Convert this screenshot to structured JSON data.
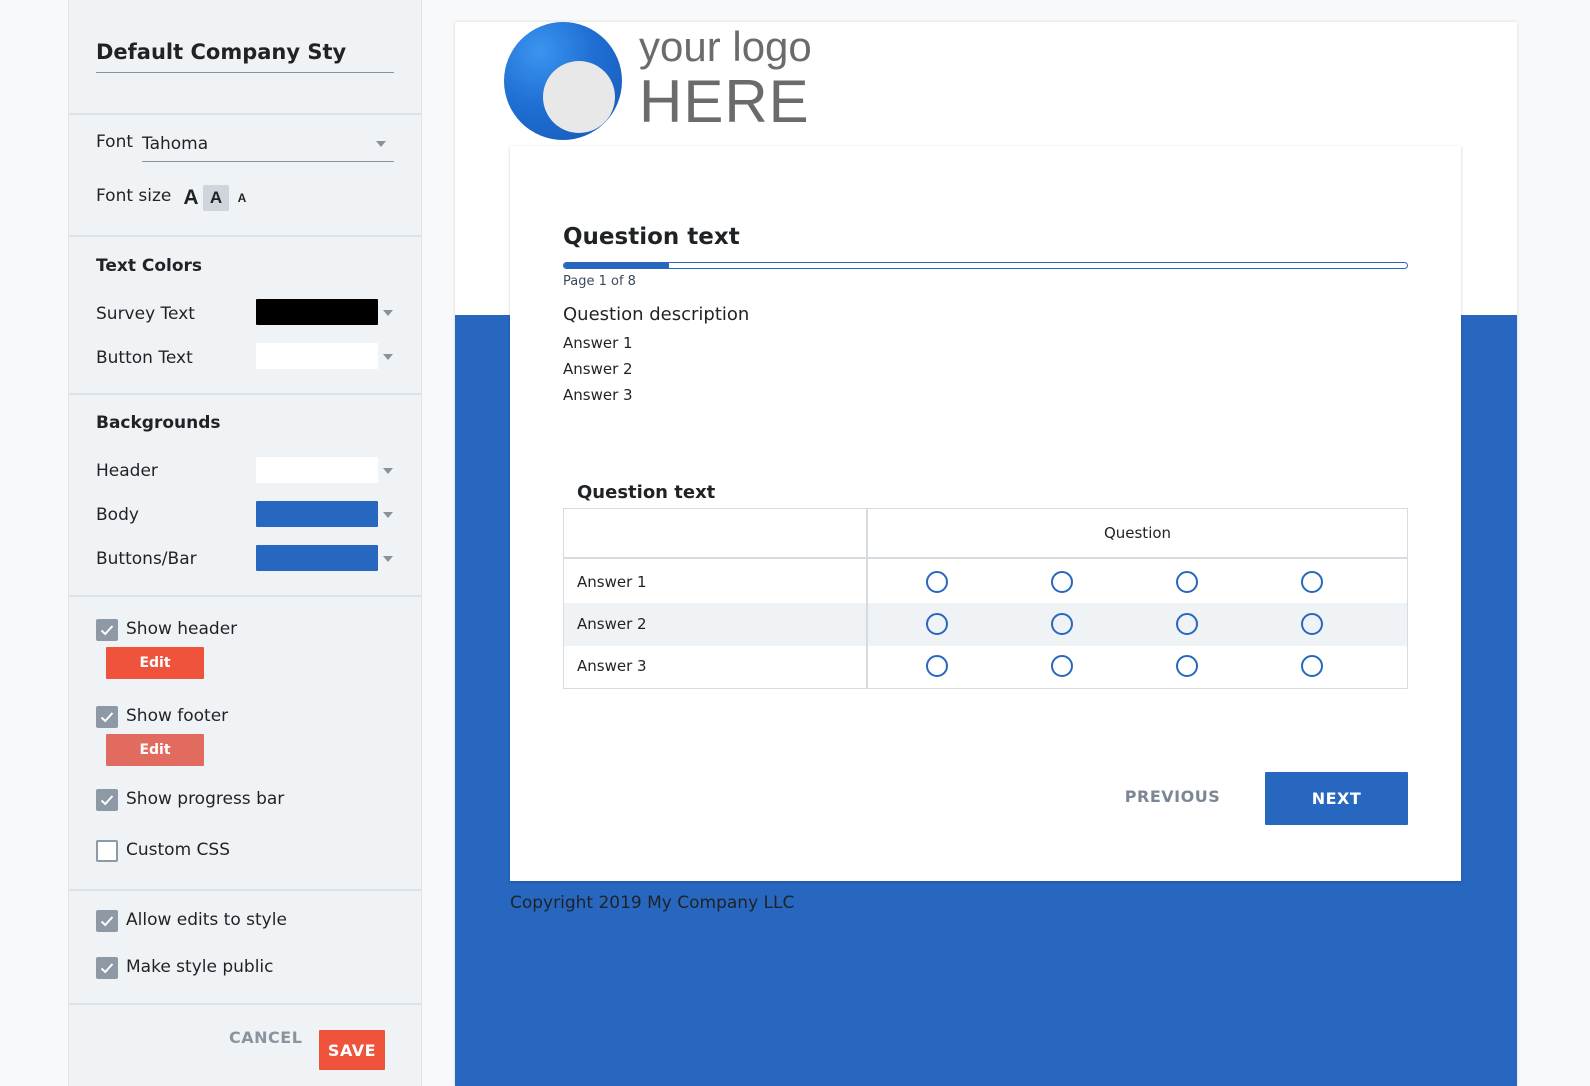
{
  "sidebar": {
    "style_name": "Default Company Sty",
    "font_label": "Font",
    "font_value": "Tahoma",
    "font_size_label": "Font size",
    "font_size_options": [
      "A",
      "A",
      "A"
    ],
    "text_colors_heading": "Text Colors",
    "survey_text_label": "Survey Text",
    "survey_text_color": "#000000",
    "button_text_label": "Button Text",
    "button_text_color": "#ffffff",
    "backgrounds_heading": "Backgrounds",
    "header_label": "Header",
    "header_color": "#ffffff",
    "body_label": "Body",
    "body_color": "#2767c0",
    "buttons_bar_label": "Buttons/Bar",
    "buttons_bar_color": "#2767c0",
    "show_header_label": "Show header",
    "show_header_checked": true,
    "edit_header_label": "Edit",
    "show_footer_label": "Show footer",
    "show_footer_checked": true,
    "edit_footer_label": "Edit",
    "show_progress_label": "Show progress bar",
    "show_progress_checked": true,
    "custom_css_label": "Custom CSS",
    "custom_css_checked": false,
    "allow_edits_label": "Allow edits to style",
    "allow_edits_checked": true,
    "make_public_label": "Make style public",
    "make_public_checked": true,
    "cancel_label": "CANCEL",
    "save_label": "SAVE"
  },
  "preview": {
    "logo_line1": "your logo",
    "logo_line2": "HERE",
    "question_title": "Question text",
    "progress_fraction": 0.125,
    "page_indicator": "Page 1 of 8",
    "question_description": "Question description",
    "answers": [
      "Answer 1",
      "Answer 2",
      "Answer 3"
    ],
    "grid_title": "Question text",
    "grid_header": "Question",
    "grid_rows": [
      "Answer 1",
      "Answer 2",
      "Answer 3"
    ],
    "previous_label": "PREVIOUS",
    "next_label": "NEXT",
    "footer_text": "Copyright 2019 My Company LLC"
  },
  "colors": {
    "accent": "#2767c0",
    "save_button": "#f0533b",
    "edit_header_button": "#f0533b",
    "edit_footer_button": "#e06b5e",
    "checkbox": "#8e99a6"
  }
}
